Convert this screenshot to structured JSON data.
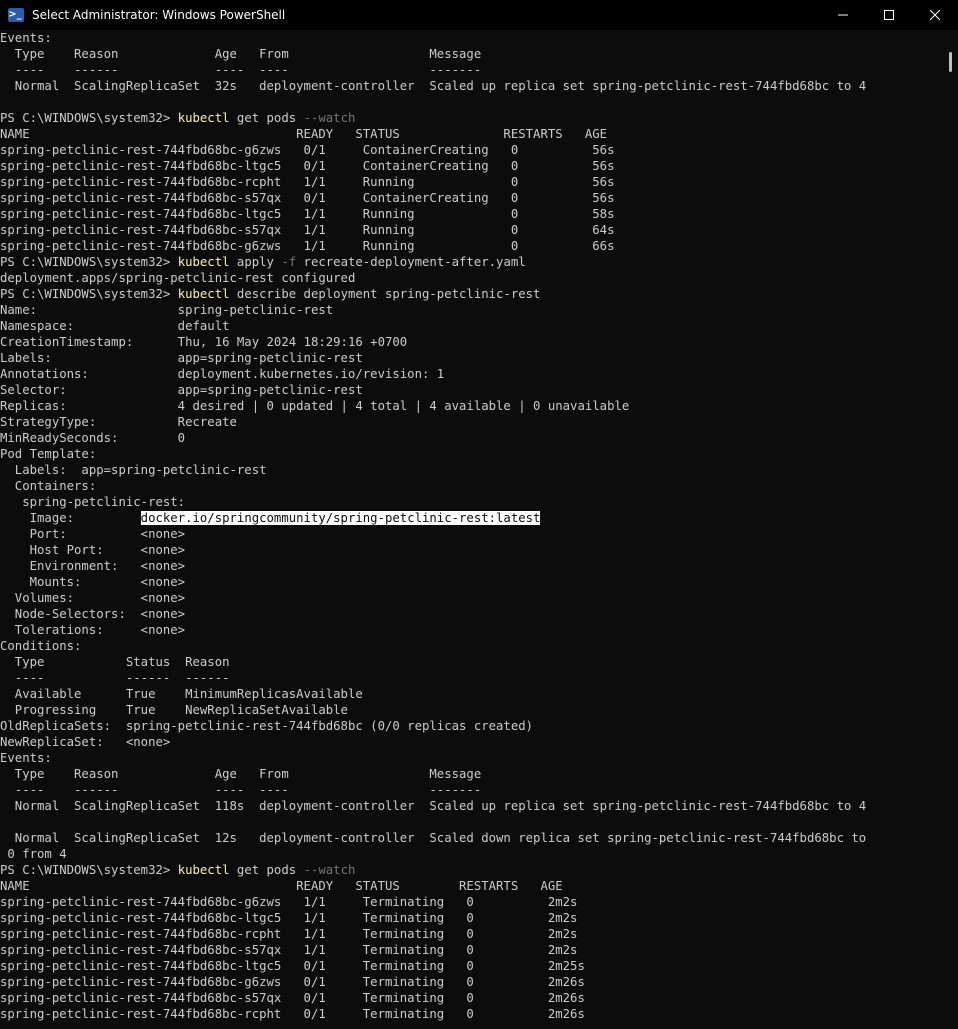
{
  "window": {
    "title": "Select Administrator: Windows PowerShell",
    "icon": "powershell-icon",
    "icon_glyph": ">_",
    "minimize_glyph": "—",
    "maximize_glyph": "☐",
    "close_glyph": "✕"
  },
  "colors": {
    "background": "#0c0c0c",
    "text": "#cccccc",
    "command": "#f9f1a5",
    "flag": "#767676",
    "selection_bg": "#ffffff"
  },
  "terminal": {
    "prompt": "PS C:\\WINDOWS\\system32> ",
    "lines": [
      {
        "segments": [
          {
            "t": "Events:"
          }
        ]
      },
      {
        "segments": [
          {
            "t": "  Type    Reason             Age   From                   Message"
          }
        ]
      },
      {
        "segments": [
          {
            "t": "  ----    ------             ----  ----                   -------"
          }
        ]
      },
      {
        "segments": [
          {
            "t": "  Normal  ScalingReplicaSet  32s   deployment-controller  Scaled up replica set spring-petclinic-rest-744fbd68bc to 4"
          }
        ]
      },
      {
        "segments": [
          {
            "t": ""
          }
        ]
      },
      {
        "segments": [
          {
            "t": "PS C:\\WINDOWS\\system32> "
          },
          {
            "t": "kubectl",
            "c": "cmd"
          },
          {
            "t": " get pods "
          },
          {
            "t": "--watch",
            "c": "flag"
          }
        ],
        "is_command": true
      },
      {
        "segments": [
          {
            "t": "NAME                                    READY   STATUS              RESTARTS   AGE"
          }
        ]
      },
      {
        "segments": [
          {
            "t": "spring-petclinic-rest-744fbd68bc-g6zws   0/1     ContainerCreating   0          56s"
          }
        ]
      },
      {
        "segments": [
          {
            "t": "spring-petclinic-rest-744fbd68bc-ltgc5   0/1     ContainerCreating   0          56s"
          }
        ]
      },
      {
        "segments": [
          {
            "t": "spring-petclinic-rest-744fbd68bc-rcpht   1/1     Running             0          56s"
          }
        ]
      },
      {
        "segments": [
          {
            "t": "spring-petclinic-rest-744fbd68bc-s57qx   0/1     ContainerCreating   0          56s"
          }
        ]
      },
      {
        "segments": [
          {
            "t": "spring-petclinic-rest-744fbd68bc-ltgc5   1/1     Running             0          58s"
          }
        ]
      },
      {
        "segments": [
          {
            "t": "spring-petclinic-rest-744fbd68bc-s57qx   1/1     Running             0          64s"
          }
        ]
      },
      {
        "segments": [
          {
            "t": "spring-petclinic-rest-744fbd68bc-g6zws   1/1     Running             0          66s"
          }
        ]
      },
      {
        "segments": [
          {
            "t": "PS C:\\WINDOWS\\system32> "
          },
          {
            "t": "kubectl",
            "c": "cmd"
          },
          {
            "t": " apply "
          },
          {
            "t": "-f",
            "c": "flag"
          },
          {
            "t": " recreate-deployment-after.yaml"
          }
        ],
        "is_command": true
      },
      {
        "segments": [
          {
            "t": "deployment.apps/spring-petclinic-rest configured"
          }
        ]
      },
      {
        "segments": [
          {
            "t": "PS C:\\WINDOWS\\system32> "
          },
          {
            "t": "kubectl",
            "c": "cmd"
          },
          {
            "t": " describe deployment spring-petclinic-rest"
          }
        ],
        "is_command": true
      },
      {
        "segments": [
          {
            "t": "Name:                   spring-petclinic-rest"
          }
        ]
      },
      {
        "segments": [
          {
            "t": "Namespace:              default"
          }
        ]
      },
      {
        "segments": [
          {
            "t": "CreationTimestamp:      Thu, 16 May 2024 18:29:16 +0700"
          }
        ]
      },
      {
        "segments": [
          {
            "t": "Labels:                 app=spring-petclinic-rest"
          }
        ]
      },
      {
        "segments": [
          {
            "t": "Annotations:            deployment.kubernetes.io/revision: 1"
          }
        ]
      },
      {
        "segments": [
          {
            "t": "Selector:               app=spring-petclinic-rest"
          }
        ]
      },
      {
        "segments": [
          {
            "t": "Replicas:               4 desired | 0 updated | 4 total | 4 available | 0 unavailable"
          }
        ]
      },
      {
        "segments": [
          {
            "t": "StrategyType:           Recreate"
          }
        ]
      },
      {
        "segments": [
          {
            "t": "MinReadySeconds:        0"
          }
        ]
      },
      {
        "segments": [
          {
            "t": "Pod Template:"
          }
        ]
      },
      {
        "segments": [
          {
            "t": "  Labels:  app=spring-petclinic-rest"
          }
        ]
      },
      {
        "segments": [
          {
            "t": "  Containers:"
          }
        ]
      },
      {
        "segments": [
          {
            "t": "   spring-petclinic-rest:"
          }
        ]
      },
      {
        "segments": [
          {
            "t": "    Image:         "
          },
          {
            "t": "docker.io/springcommunity/spring-petclinic-rest:latest",
            "c": "sel"
          }
        ]
      },
      {
        "segments": [
          {
            "t": "    Port:          <none>"
          }
        ]
      },
      {
        "segments": [
          {
            "t": "    Host Port:     <none>"
          }
        ]
      },
      {
        "segments": [
          {
            "t": "    Environment:   <none>"
          }
        ]
      },
      {
        "segments": [
          {
            "t": "    Mounts:        <none>"
          }
        ]
      },
      {
        "segments": [
          {
            "t": "  Volumes:         <none>"
          }
        ]
      },
      {
        "segments": [
          {
            "t": "  Node-Selectors:  <none>"
          }
        ]
      },
      {
        "segments": [
          {
            "t": "  Tolerations:     <none>"
          }
        ]
      },
      {
        "segments": [
          {
            "t": "Conditions:"
          }
        ]
      },
      {
        "segments": [
          {
            "t": "  Type           Status  Reason"
          }
        ]
      },
      {
        "segments": [
          {
            "t": "  ----           ------  ------"
          }
        ]
      },
      {
        "segments": [
          {
            "t": "  Available      True    MinimumReplicasAvailable"
          }
        ]
      },
      {
        "segments": [
          {
            "t": "  Progressing    True    NewReplicaSetAvailable"
          }
        ]
      },
      {
        "segments": [
          {
            "t": "OldReplicaSets:  spring-petclinic-rest-744fbd68bc (0/0 replicas created)"
          }
        ]
      },
      {
        "segments": [
          {
            "t": "NewReplicaSet:   <none>"
          }
        ]
      },
      {
        "segments": [
          {
            "t": "Events:"
          }
        ]
      },
      {
        "segments": [
          {
            "t": "  Type    Reason             Age   From                   Message"
          }
        ]
      },
      {
        "segments": [
          {
            "t": "  ----    ------             ----  ----                   -------"
          }
        ]
      },
      {
        "segments": [
          {
            "t": "  Normal  ScalingReplicaSet  118s  deployment-controller  Scaled up replica set spring-petclinic-rest-744fbd68bc to 4"
          }
        ]
      },
      {
        "segments": [
          {
            "t": ""
          }
        ]
      },
      {
        "segments": [
          {
            "t": "  Normal  ScalingReplicaSet  12s   deployment-controller  Scaled down replica set spring-petclinic-rest-744fbd68bc to"
          }
        ]
      },
      {
        "segments": [
          {
            "t": " 0 from 4"
          }
        ]
      },
      {
        "segments": [
          {
            "t": "PS C:\\WINDOWS\\system32> "
          },
          {
            "t": "kubectl",
            "c": "cmd"
          },
          {
            "t": " get pods "
          },
          {
            "t": "--watch",
            "c": "flag"
          }
        ],
        "is_command": true
      },
      {
        "segments": [
          {
            "t": "NAME                                    READY   STATUS        RESTARTS   AGE"
          }
        ]
      },
      {
        "segments": [
          {
            "t": "spring-petclinic-rest-744fbd68bc-g6zws   1/1     Terminating   0          2m2s"
          }
        ]
      },
      {
        "segments": [
          {
            "t": "spring-petclinic-rest-744fbd68bc-ltgc5   1/1     Terminating   0          2m2s"
          }
        ]
      },
      {
        "segments": [
          {
            "t": "spring-petclinic-rest-744fbd68bc-rcpht   1/1     Terminating   0          2m2s"
          }
        ]
      },
      {
        "segments": [
          {
            "t": "spring-petclinic-rest-744fbd68bc-s57qx   1/1     Terminating   0          2m2s"
          }
        ]
      },
      {
        "segments": [
          {
            "t": "spring-petclinic-rest-744fbd68bc-ltgc5   0/1     Terminating   0          2m25s"
          }
        ]
      },
      {
        "segments": [
          {
            "t": "spring-petclinic-rest-744fbd68bc-g6zws   0/1     Terminating   0          2m26s"
          }
        ]
      },
      {
        "segments": [
          {
            "t": "spring-petclinic-rest-744fbd68bc-s57qx   0/1     Terminating   0          2m26s"
          }
        ]
      },
      {
        "segments": [
          {
            "t": "spring-petclinic-rest-744fbd68bc-rcpht   0/1     Terminating   0          2m26s"
          }
        ]
      }
    ]
  }
}
